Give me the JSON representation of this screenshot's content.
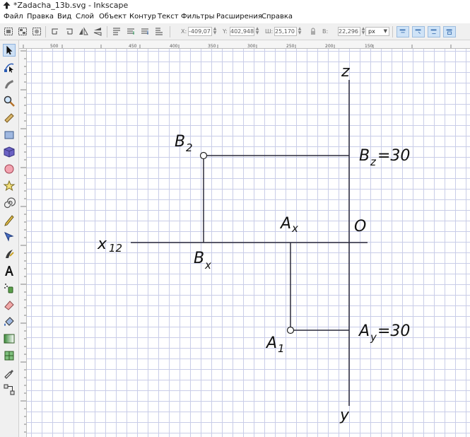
{
  "window": {
    "title": "*Zadacha_13b.svg - Inkscape"
  },
  "menu": [
    "Файл",
    "Правка",
    "Вид",
    "Слой",
    "Объект",
    "Контур",
    "Текст",
    "Фильтры",
    "Расширения",
    "Справка"
  ],
  "toolbar": {
    "x_label": "X:",
    "x_value": "-409,07",
    "y_label": "Y:",
    "y_value": "402,948",
    "w_label": "Ш:",
    "w_value": "25,170",
    "h_label": "В:",
    "h_value": "22,296",
    "unit": "px"
  },
  "rulers": {
    "top_ticks": [
      "500",
      "450",
      "400",
      "350",
      "300",
      "250",
      "200",
      "150"
    ]
  },
  "drawing": {
    "axis_z": "z",
    "axis_y": "y",
    "axis_x_main": "x",
    "axis_x_sub": "12",
    "origin": "O",
    "b2_main": "B",
    "b2_sub": "2",
    "bz_main": "B",
    "bz_sub": "z",
    "bz_value": "=30",
    "bx_main": "B",
    "bx_sub": "x",
    "ax_main": "A",
    "ax_sub": "x",
    "a1_main": "A",
    "a1_sub": "1",
    "ay_main": "A",
    "ay_sub": "y",
    "ay_value": "=30"
  }
}
